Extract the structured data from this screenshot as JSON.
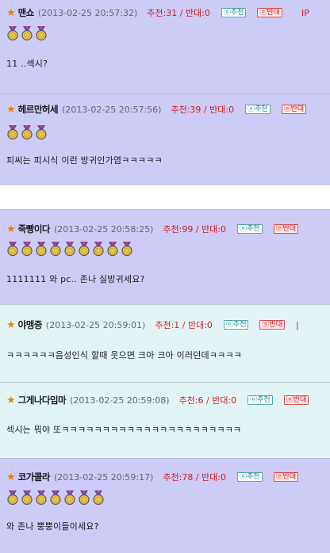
{
  "comments": [
    {
      "nick": "맨쇼",
      "date": "(2013-02-25 20:57:32)",
      "votes": "추천:31 / 반대:0",
      "up": "ⓞ추천",
      "down": "ⓞ반대",
      "extra": "IP",
      "medals": 3,
      "text": "11 ..섹시?"
    },
    {
      "nick": "헤르만허세",
      "date": "(2013-02-25 20:57:56)",
      "votes": "추천:39 / 반대:0",
      "up": "ⓞ추천",
      "down": "ⓞ반대",
      "medals": 3,
      "text": "피씨는 피시식 이런 방귀인가염ㅋㅋㅋㅋㅋ"
    },
    {
      "nick": "죽빵이다",
      "date": "(2013-02-25 20:58:25)",
      "votes": "추천:99 / 반대:0",
      "up": "ⓞ추천",
      "down": "ⓞ반대",
      "medals": 9,
      "text": "1111111 와 pc.. 존나 실방귀세요?"
    },
    {
      "nick": "야멩증",
      "date": "(2013-02-25 20:59:01)",
      "votes": "추천:1 / 반대:0",
      "up": "ⓞ추천",
      "down": "ⓞ반대",
      "extra": "|",
      "medals": 0,
      "text": "ㅋㅋㅋㅋㅋㅋ음성인식 할때 웃으면 크아 크아 이러던데ㅋㅋㅋㅋ"
    },
    {
      "nick": "그게나다임마",
      "date": "(2013-02-25 20:59:08)",
      "votes": "추천:6 / 반대:0",
      "up": "ⓞ추천",
      "down": "ⓞ반대",
      "medals": 0,
      "text": "섹시는 뭐야 또ㅋㅋㅋㅋㅋㅋㅋㅋㅋㅋㅋㅋㅋㅋㅋㅋㅋㅋㅋㅋㅋㅋ"
    },
    {
      "nick": "코가콜라",
      "date": "(2013-02-25 20:59:17)",
      "votes": "추천:78 / 반대:0",
      "up": "ⓞ추천",
      "down": "ⓞ반대",
      "medals": 7,
      "text": "와 존나 뿡뿡이들이세요?"
    }
  ],
  "colors": {
    "lavender": "#ccccf7",
    "cyan": "#e3f4f7",
    "vote": "#cc2020",
    "star": "#e08a00",
    "medal_gold": "#e8c34a"
  },
  "icons": {
    "star": "star-icon",
    "medal": "medal-icon"
  }
}
